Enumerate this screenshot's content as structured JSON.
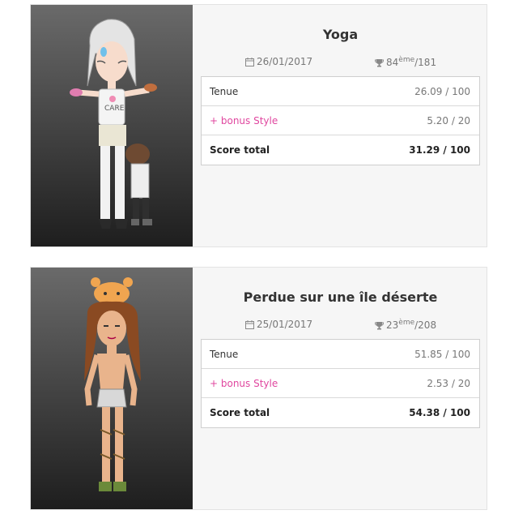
{
  "results": [
    {
      "title": "Yoga",
      "date": "26/01/2017",
      "rank": "84",
      "rank_suffix": "ème",
      "rank_total": "/181",
      "rows": [
        {
          "label": "Tenue",
          "value": "26.09 / 100"
        },
        {
          "label": "+ bonus Style",
          "value": "5.20 / 20"
        },
        {
          "label": "Score total",
          "value": "31.29 / 100"
        }
      ]
    },
    {
      "title": "Perdue sur une île déserte",
      "date": "25/01/2017",
      "rank": "23",
      "rank_suffix": "ème",
      "rank_total": "/208",
      "rows": [
        {
          "label": "Tenue",
          "value": "51.85 / 100"
        },
        {
          "label": "+ bonus Style",
          "value": "2.53 / 20"
        },
        {
          "label": "Score total",
          "value": "54.38 / 100"
        }
      ]
    }
  ],
  "colors": {
    "bonus": "#e0479f",
    "card_bg": "#f6f6f6"
  }
}
